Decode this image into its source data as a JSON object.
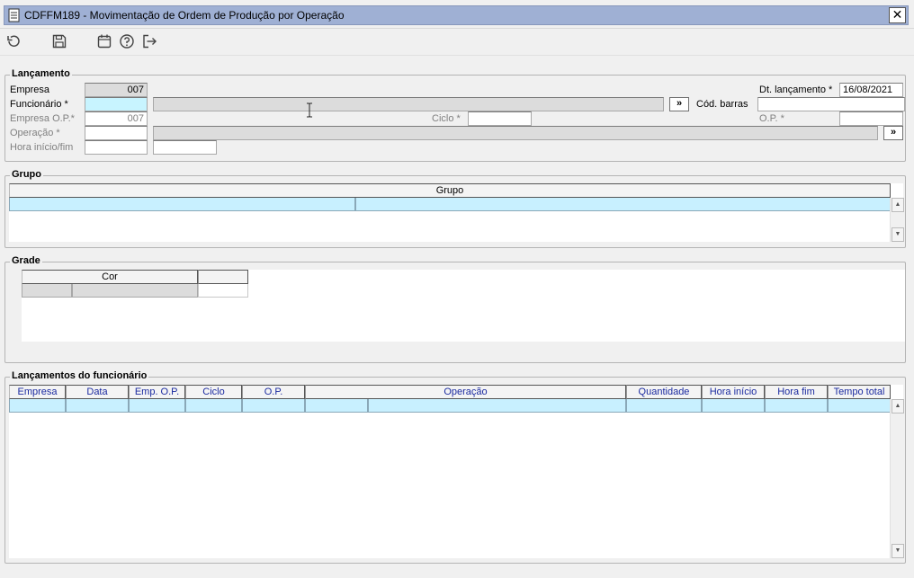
{
  "window": {
    "title": "CDFFM189 - Movimentação de Ordem de Produção por Operação",
    "close_label": "✕"
  },
  "toolbar": {
    "icons": [
      "undo-icon",
      "save-icon",
      "calendar-icon",
      "help-icon",
      "exit-icon"
    ]
  },
  "lancamento": {
    "group_label": "Lançamento",
    "empresa_label": "Empresa",
    "empresa_value": "007",
    "funcionario_label": "Funcionário *",
    "funcionario_value": "",
    "funcionario_nome": "",
    "lookup_button": "»",
    "cod_barras_label": "Cód. barras",
    "cod_barras_value": "",
    "dt_lancamento_label": "Dt. lançamento *",
    "dt_lancamento_value": "16/08/2021",
    "empresa_op_label": "Empresa O.P.*",
    "empresa_op_value": "007",
    "ciclo_label": "Ciclo *",
    "ciclo_value": "",
    "op_label": "O.P. *",
    "op_value": "",
    "operacao_label": "Operação *",
    "operacao_value": "",
    "operacao_desc": "",
    "operacao_button": "»",
    "hora_label": "Hora início/fim",
    "hora_inicio": "",
    "hora_fim": ""
  },
  "grupo": {
    "group_label": "Grupo",
    "columns": [
      "Grupo"
    ]
  },
  "grade": {
    "group_label": "Grade",
    "columns": [
      "Cor",
      ""
    ]
  },
  "lancamentos_funcionario": {
    "group_label": "Lançamentos do funcionário",
    "columns": [
      "Empresa",
      "Data",
      "Emp. O.P.",
      "Ciclo",
      "O.P.",
      "Operação",
      "Quantidade",
      "Hora início",
      "Hora fim",
      "Tempo total"
    ]
  }
}
